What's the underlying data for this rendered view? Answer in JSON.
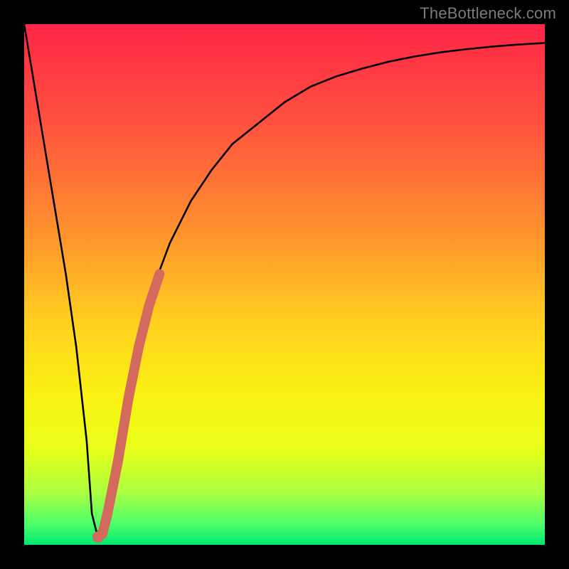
{
  "attribution": "TheBottleneck.com",
  "colors": {
    "frame": "#000000",
    "gradient_stops": [
      {
        "offset": 0.0,
        "color": "#ff2646"
      },
      {
        "offset": 0.18,
        "color": "#ff4f3f"
      },
      {
        "offset": 0.38,
        "color": "#ff8c2f"
      },
      {
        "offset": 0.58,
        "color": "#ffd21f"
      },
      {
        "offset": 0.72,
        "color": "#faf312"
      },
      {
        "offset": 0.82,
        "color": "#e6ff1a"
      },
      {
        "offset": 0.9,
        "color": "#abff40"
      },
      {
        "offset": 0.96,
        "color": "#4dff6a"
      },
      {
        "offset": 1.0,
        "color": "#00e86f"
      }
    ],
    "curve": "#000000",
    "highlight": "#d46a5e"
  },
  "chart_data": {
    "type": "line",
    "title": "",
    "xlabel": "",
    "ylabel": "",
    "xlim": [
      0,
      100
    ],
    "ylim": [
      0,
      100
    ],
    "grid": false,
    "series": [
      {
        "name": "bottleneck-curve",
        "x": [
          0,
          2,
          4,
          6,
          8,
          10,
          12,
          13,
          14,
          16,
          18,
          20,
          22,
          25,
          28,
          32,
          36,
          40,
          45,
          50,
          55,
          60,
          65,
          70,
          75,
          80,
          85,
          90,
          95,
          100
        ],
        "y": [
          100,
          88,
          76,
          64,
          52,
          38,
          20,
          6,
          2,
          6,
          16,
          28,
          38,
          50,
          58,
          66,
          72,
          77,
          81,
          85,
          88,
          90,
          91.5,
          92.8,
          93.8,
          94.6,
          95.2,
          95.7,
          96.1,
          96.4
        ]
      }
    ],
    "annotations": [
      {
        "name": "highlight-segment",
        "x": [
          15,
          16,
          18,
          20,
          22,
          24,
          26
        ],
        "y": [
          2,
          6,
          16,
          28,
          38,
          46,
          52
        ],
        "stroke_width": 14
      },
      {
        "name": "highlight-anchor-dot",
        "x": 14.2,
        "y": 1.5,
        "r": 8
      }
    ]
  }
}
